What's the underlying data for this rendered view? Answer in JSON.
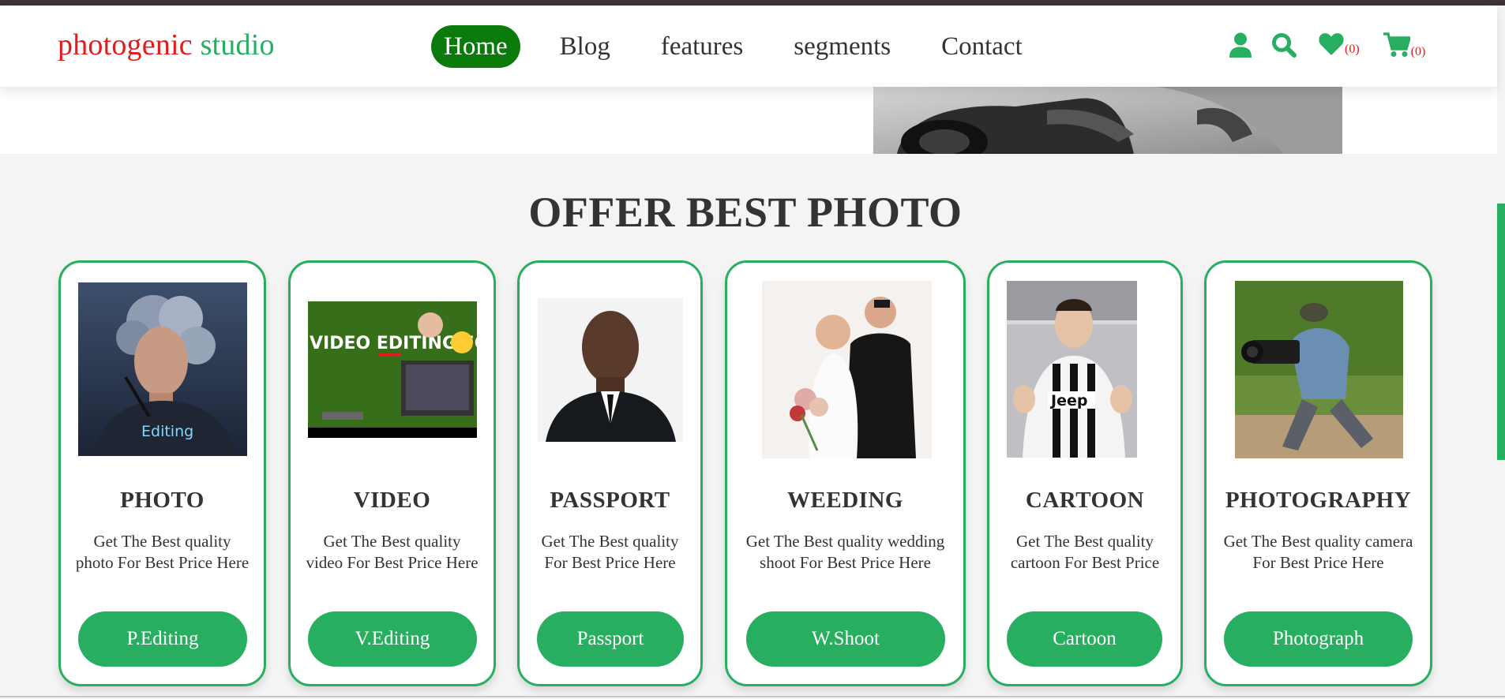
{
  "brand": {
    "part1": "photogenic",
    "part2": "studio"
  },
  "nav": {
    "items": [
      {
        "label": "Home"
      },
      {
        "label": "Blog"
      },
      {
        "label": "features"
      },
      {
        "label": "segments"
      },
      {
        "label": "Contact"
      }
    ],
    "active_index": 0
  },
  "header_icons": {
    "wishlist_count": "(0)",
    "cart_count": "(0)"
  },
  "section": {
    "title": "OFFER BEST PHOTO"
  },
  "cards": [
    {
      "title": "PHOTO",
      "desc": "Get The Best quality photo For Best Price Here",
      "button": "P.Editing",
      "image_text": "Editing"
    },
    {
      "title": "VIDEO",
      "desc": "Get The Best quality video For Best Price Here",
      "button": "V.Editing",
      "image_text": "VIDEO EDITING FOR BEGINNERS"
    },
    {
      "title": "PASSPORT",
      "desc": "Get The Best quality For Best Price Here",
      "button": "Passport"
    },
    {
      "title": "WEEDING",
      "desc": "Get The Best quality wedding shoot For Best Price Here",
      "button": "W.Shoot"
    },
    {
      "title": "CARTOON",
      "desc": "Get The Best quality cartoon For Best Price",
      "button": "Cartoon",
      "image_text": "Jeep"
    },
    {
      "title": "PHOTOGRAPHY",
      "desc": "Get The Best quality camera For Best Price Here",
      "button": "Photograph"
    }
  ],
  "colors": {
    "accent": "#27ae60",
    "brand_red": "#e31b1b",
    "active_nav": "#0a7a0a"
  }
}
